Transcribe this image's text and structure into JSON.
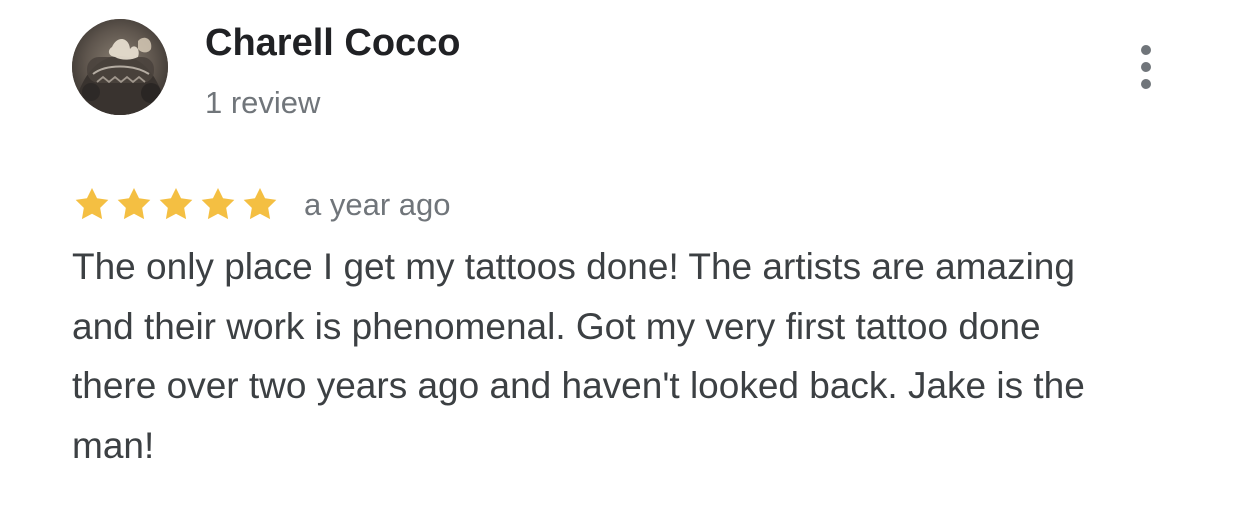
{
  "reviewer": {
    "name": "Charell Cocco",
    "review_count": "1 review",
    "avatar_icon": "user-avatar-photo"
  },
  "menu": {
    "icon": "more-vert-icon"
  },
  "review": {
    "rating": 5,
    "rating_max": 5,
    "star_color": "#f4bf42",
    "time": "a year ago",
    "text": "The only place I get my tattoos done! The artists are amazing and their work is phenomenal. Got my very first tattoo done there over two years ago and haven't looked back. Jake is the man!"
  },
  "colors": {
    "name_text": "#202124",
    "meta_text": "#70757a",
    "body_text": "#3c4043",
    "menu_dots": "#70757a"
  }
}
